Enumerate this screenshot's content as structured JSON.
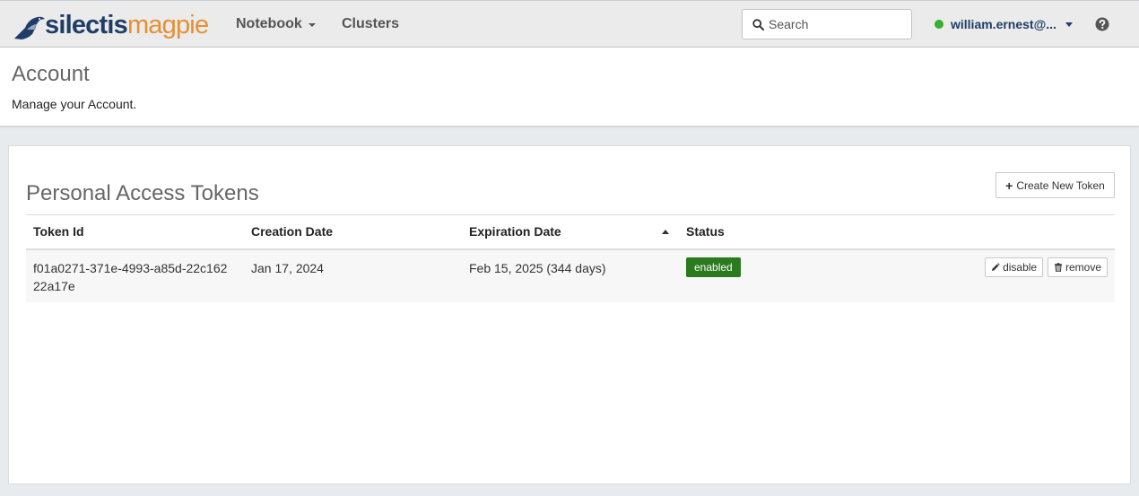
{
  "navbar": {
    "brand": {
      "part1": "silectis",
      "part2": "magpie"
    },
    "links": [
      {
        "label": "Notebook",
        "has_dropdown": true
      },
      {
        "label": "Clusters",
        "has_dropdown": false
      }
    ],
    "search": {
      "placeholder": "Search",
      "value": ""
    },
    "user": {
      "name": "william.ernest@...",
      "status_color": "#35b130"
    }
  },
  "page": {
    "title": "Account",
    "subtitle": "Manage your Account."
  },
  "tokens_panel": {
    "title": "Personal Access Tokens",
    "create_button": "Create New Token",
    "columns": [
      "Token Id",
      "Creation Date",
      "Expiration Date",
      "Status"
    ],
    "sorted_column": "Expiration Date",
    "sort_direction": "ascending",
    "rows": [
      {
        "token_id_line1": "f01a0271-371e-4993-a85d-22c162",
        "token_id_line2": "22a17e",
        "creation_date": "Jan 17, 2024",
        "expiration_date": "Feb 15, 2025 (344 days)",
        "status": "enabled",
        "disable_label": "disable",
        "remove_label": "remove"
      }
    ]
  },
  "colors": {
    "brand_dark": "#1f3d66",
    "brand_orange": "#e88f32",
    "status_enabled": "#2a7a1e"
  }
}
